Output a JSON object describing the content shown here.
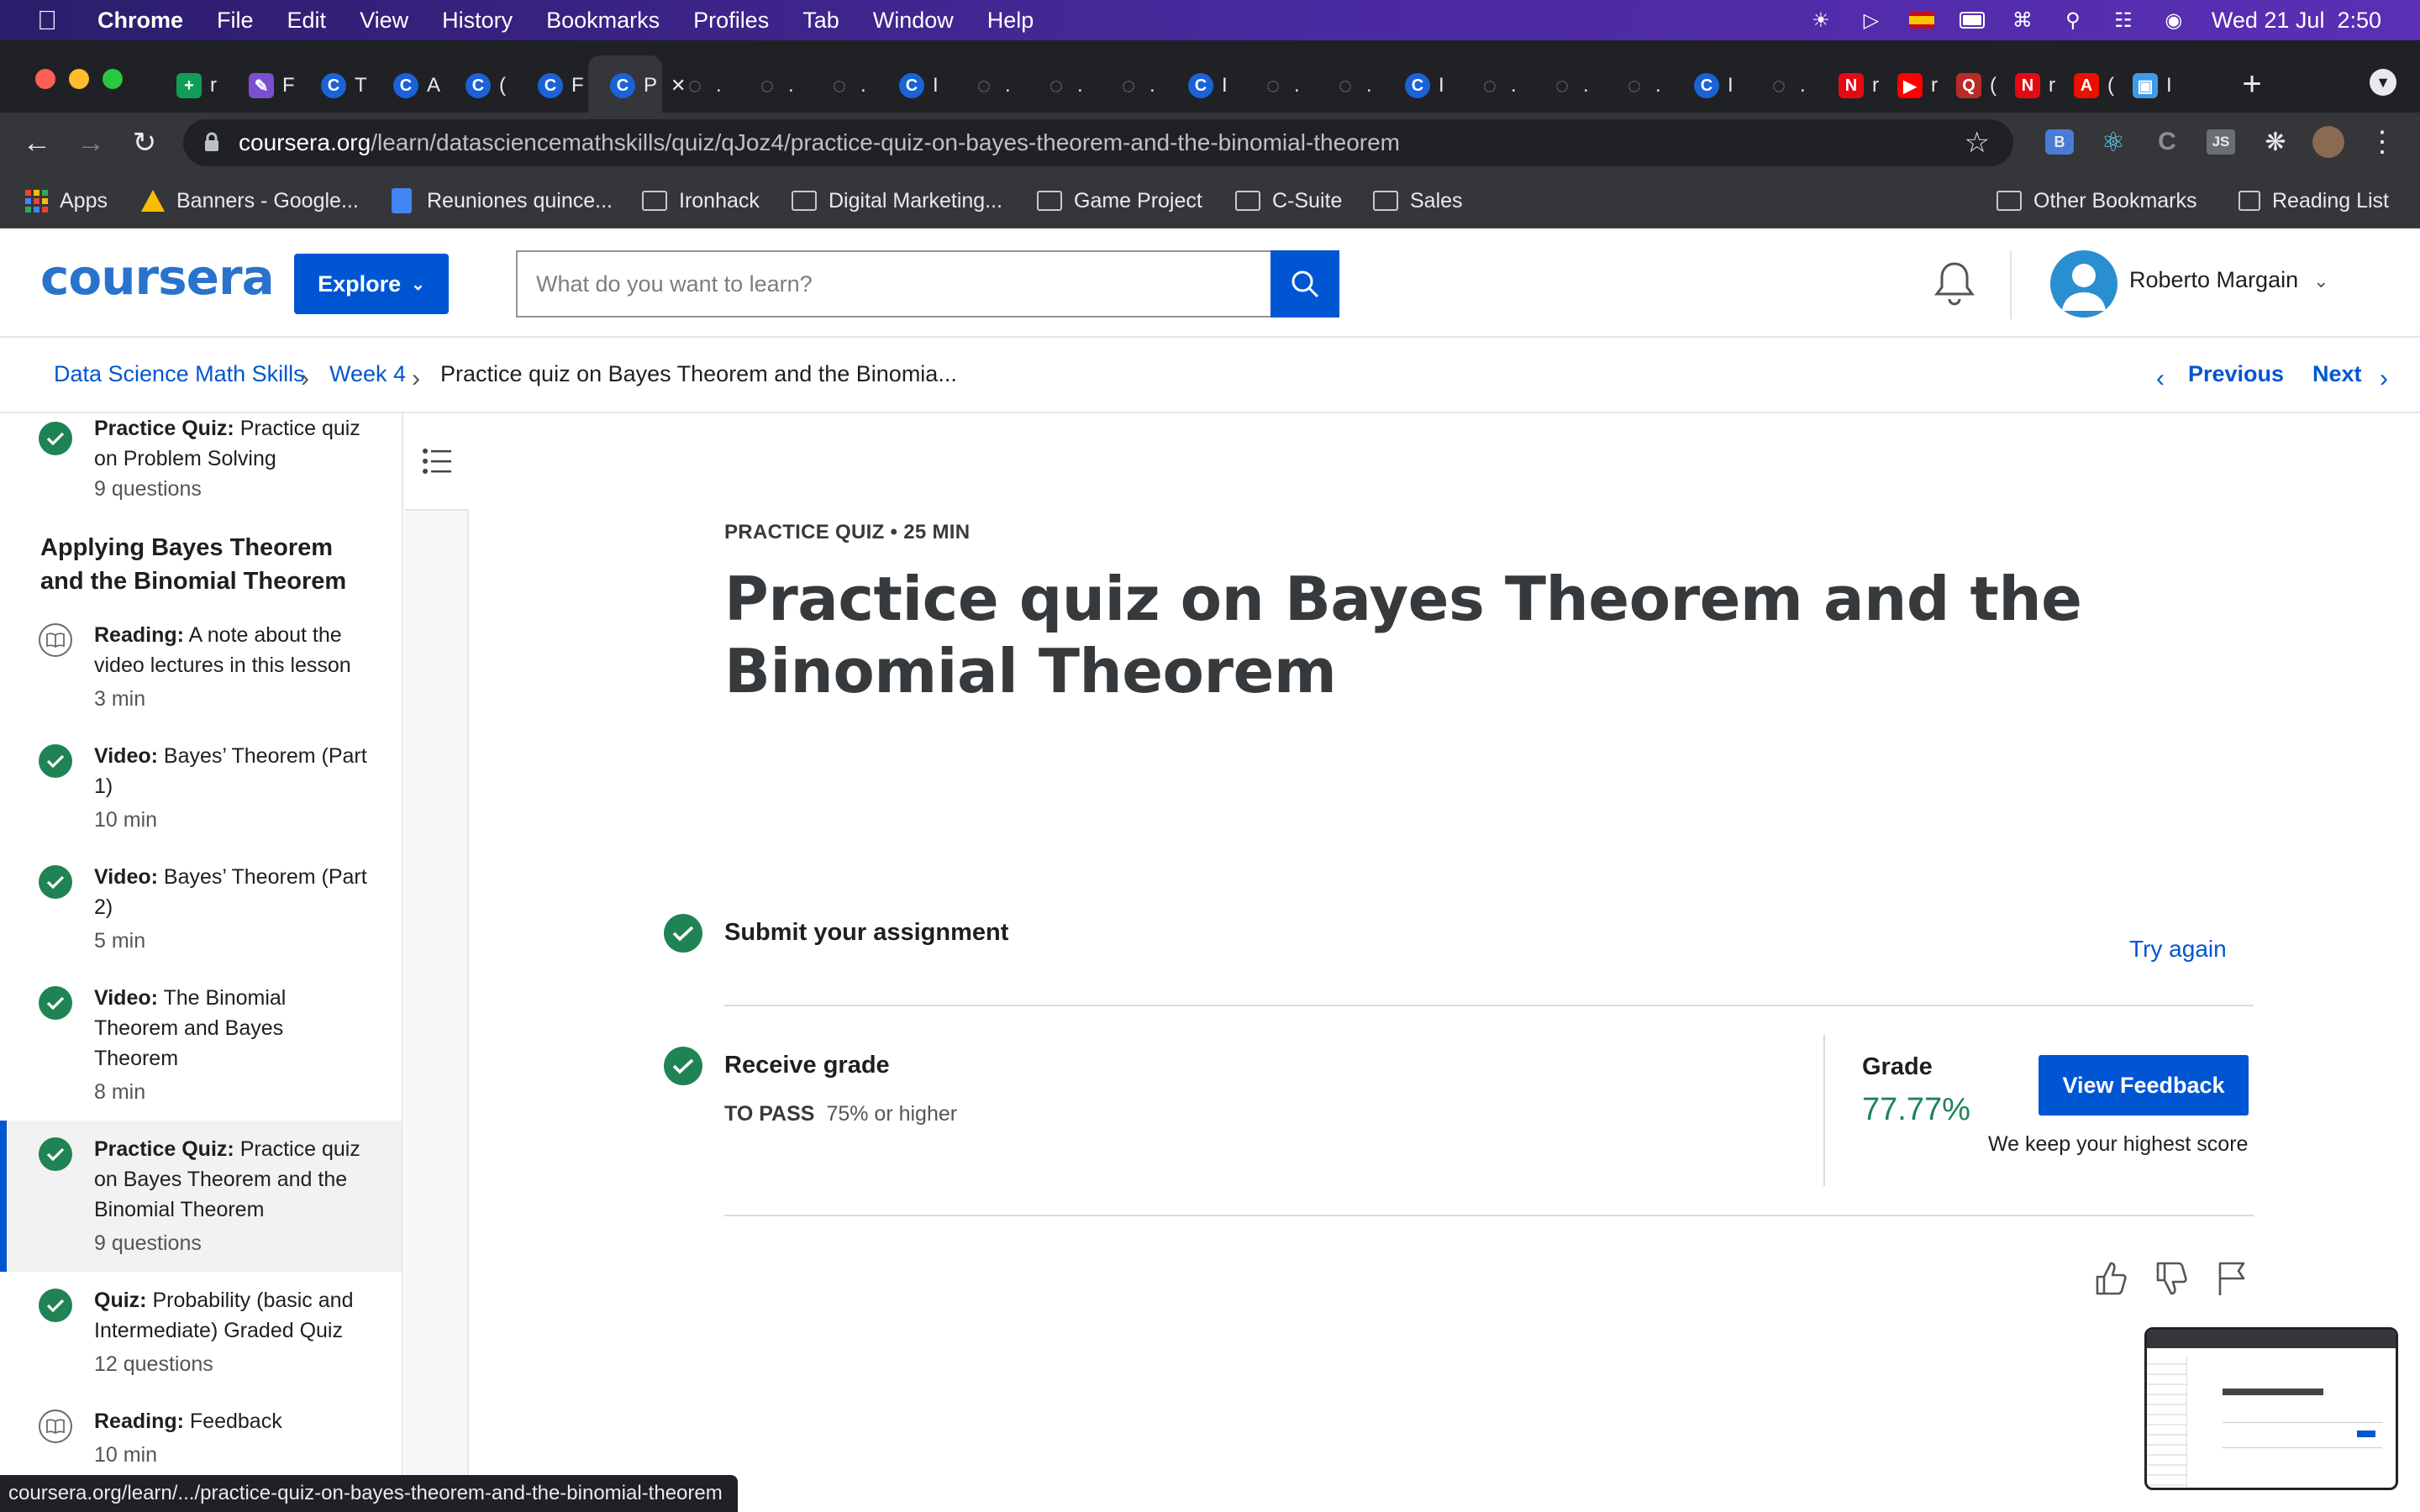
{
  "menubar": {
    "app": "Chrome",
    "items": [
      "File",
      "Edit",
      "View",
      "History",
      "Bookmarks",
      "Profiles",
      "Tab",
      "Window",
      "Help"
    ],
    "datetime": "Wed 21 Jul  2:50"
  },
  "tabs": [
    {
      "icon": "sheets-icon",
      "label": "r"
    },
    {
      "icon": "pen-icon",
      "label": "F"
    },
    {
      "icon": "coursera-icon",
      "label": "T"
    },
    {
      "icon": "coursera-icon",
      "label": "A"
    },
    {
      "icon": "coursera-icon",
      "label": "("
    },
    {
      "icon": "coursera-icon",
      "label": "F"
    },
    {
      "icon": "coursera-icon",
      "label": "P",
      "active": true
    },
    {
      "icon": "globe-icon",
      "label": "."
    },
    {
      "icon": "globe-icon",
      "label": "."
    },
    {
      "icon": "globe-icon",
      "label": "."
    },
    {
      "icon": "coursera-icon",
      "label": "I"
    },
    {
      "icon": "globe-icon",
      "label": "."
    },
    {
      "icon": "globe-icon",
      "label": "."
    },
    {
      "icon": "globe-icon",
      "label": "."
    },
    {
      "icon": "coursera-icon",
      "label": "I"
    },
    {
      "icon": "globe-icon",
      "label": "."
    },
    {
      "icon": "globe-icon",
      "label": "."
    },
    {
      "icon": "coursera-icon",
      "label": "I"
    },
    {
      "icon": "globe-icon",
      "label": "."
    },
    {
      "icon": "globe-icon",
      "label": "."
    },
    {
      "icon": "globe-icon",
      "label": "."
    },
    {
      "icon": "coursera-icon",
      "label": "I"
    },
    {
      "icon": "globe-icon",
      "label": "."
    },
    {
      "icon": "netflix-icon",
      "label": "r"
    },
    {
      "icon": "youtube-icon",
      "label": "r"
    },
    {
      "icon": "quora-icon",
      "label": "("
    },
    {
      "icon": "netflix-icon",
      "label": "r"
    },
    {
      "icon": "adobe-icon",
      "label": "("
    },
    {
      "icon": "app-icon",
      "label": "I"
    }
  ],
  "url": {
    "host": "coursera.org",
    "path": "/learn/datasciencemathskills/quiz/qJoz4/practice-quiz-on-bayes-theorem-and-the-binomial-theorem"
  },
  "bookmarks": [
    "Apps",
    "Banners - Google...",
    "Reuniones quince...",
    "Ironhack",
    "Digital Marketing...",
    "Game Project",
    "C-Suite",
    "Sales"
  ],
  "bookmarks_right": [
    "Other Bookmarks",
    "Reading List"
  ],
  "header": {
    "logo": "coursera",
    "explore": "Explore",
    "search_placeholder": "What do you want to learn?",
    "user": "Roberto Margain"
  },
  "breadcrumb": [
    "Data Science Math Skills",
    "Week 4",
    "Practice quiz on Bayes Theorem and the Binomia..."
  ],
  "nav": {
    "previous": "Previous",
    "next": "Next"
  },
  "sidebar": {
    "top_item": {
      "type": "Practice Quiz:",
      "title": "Practice quiz on Problem Solving",
      "meta": "9 questions"
    },
    "section": "Applying Bayes Theorem and the Binomial Theorem",
    "items": [
      {
        "type": "Reading:",
        "title": "A note about the video lectures in this lesson",
        "meta": "3 min",
        "icon": "book"
      },
      {
        "type": "Video:",
        "title": "Bayes’ Theorem (Part 1)",
        "meta": "10 min",
        "icon": "check"
      },
      {
        "type": "Video:",
        "title": "Bayes’ Theorem (Part 2)",
        "meta": "5 min",
        "icon": "check"
      },
      {
        "type": "Video:",
        "title": "The Binomial Theorem and Bayes Theorem",
        "meta": "8 min",
        "icon": "check"
      },
      {
        "type": "Practice Quiz:",
        "title": "Practice quiz on Bayes Theorem and the Binomial Theorem",
        "meta": "9 questions",
        "icon": "check",
        "active": true
      },
      {
        "type": "Quiz:",
        "title": "Probability (basic and Intermediate) Graded Quiz",
        "meta": "12 questions",
        "icon": "check"
      },
      {
        "type": "Reading:",
        "title": "Feedback",
        "meta": "10 min",
        "icon": "book"
      }
    ]
  },
  "main": {
    "kicker": "PRACTICE QUIZ • 25 MIN",
    "title": "Practice quiz on Bayes Theorem and the Binomial Theorem",
    "submit": "Submit your assignment",
    "try_again": "Try again",
    "receive": "Receive grade",
    "to_pass_label": "TO PASS",
    "to_pass_value": "75% or higher",
    "grade_label": "Grade",
    "grade_value": "77.77%",
    "view_feedback": "View Feedback",
    "keep": "We keep your highest score"
  },
  "status_url": "coursera.org/learn/.../practice-quiz-on-bayes-theorem-and-the-binomial-theorem",
  "colors": {
    "brand": "#0056d2",
    "success": "#1f8354",
    "menubar": "#4a2aa0"
  }
}
